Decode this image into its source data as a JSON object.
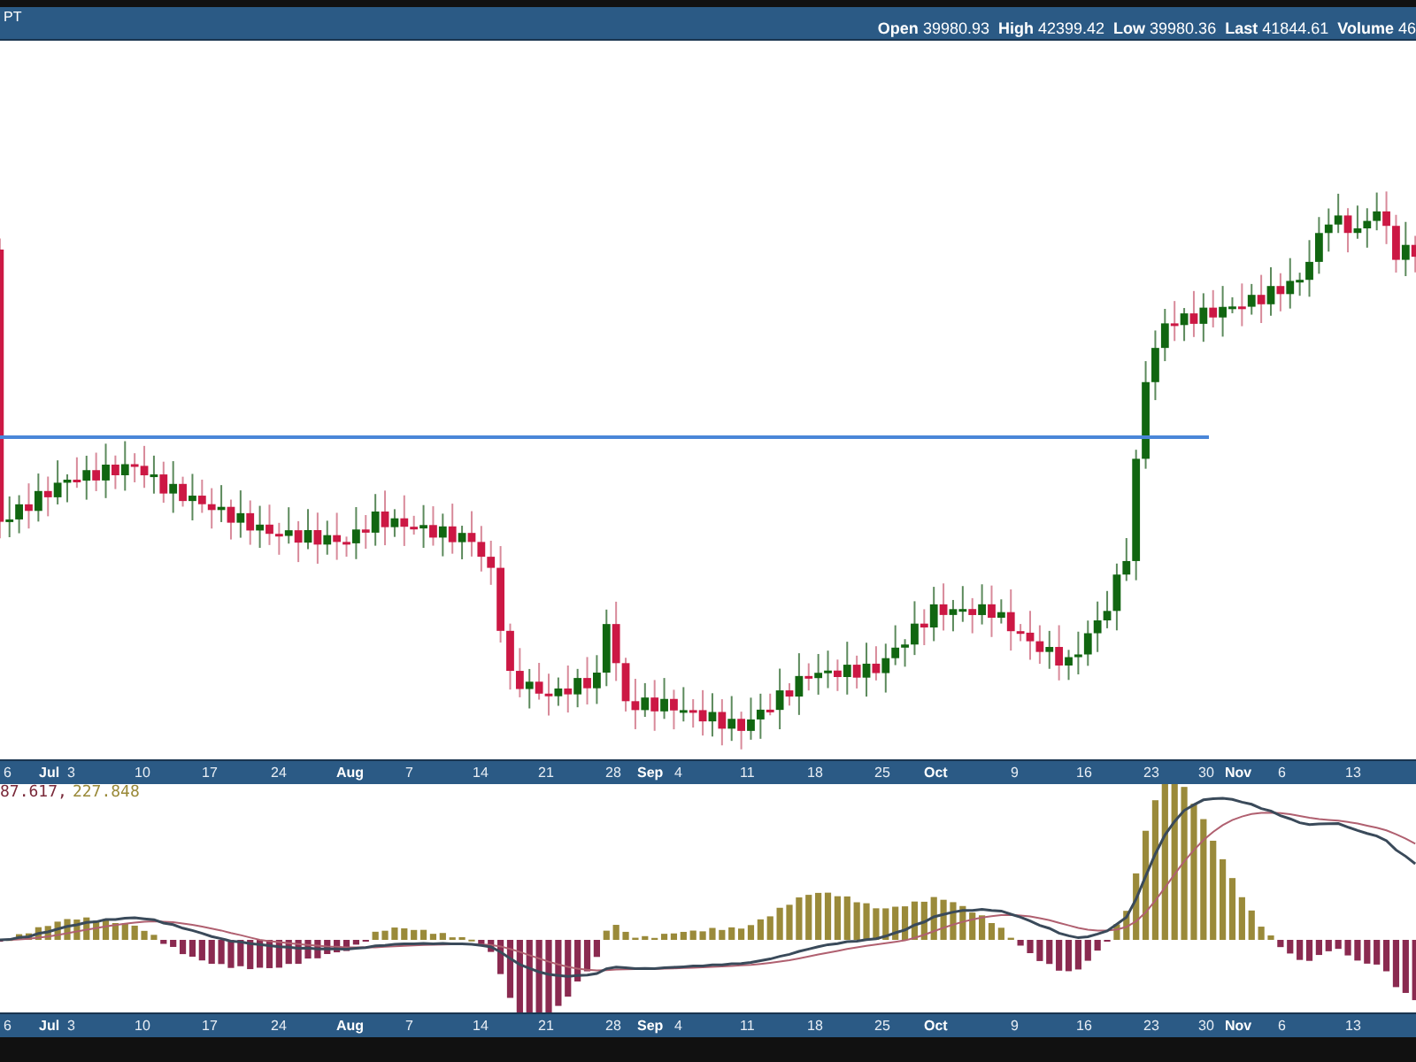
{
  "header": {
    "symbol": "PT",
    "stats": [
      {
        "label": "Open",
        "value": "39980.93"
      },
      {
        "label": "High",
        "value": "42399.42"
      },
      {
        "label": "Low",
        "value": "39980.36"
      },
      {
        "label": "Last",
        "value": "41844.61"
      },
      {
        "label": "Volume",
        "value": "46"
      }
    ]
  },
  "price_axis": {
    "labels": [
      {
        "text": "6",
        "kind": "day"
      },
      {
        "text": "Jul",
        "kind": "month"
      },
      {
        "text": "3",
        "kind": "day"
      },
      {
        "text": "10",
        "kind": "day"
      },
      {
        "text": "17",
        "kind": "day"
      },
      {
        "text": "24",
        "kind": "day"
      },
      {
        "text": "Aug",
        "kind": "month"
      },
      {
        "text": "7",
        "kind": "day"
      },
      {
        "text": "14",
        "kind": "day"
      },
      {
        "text": "21",
        "kind": "day"
      },
      {
        "text": "28",
        "kind": "day"
      },
      {
        "text": "Sep",
        "kind": "month"
      },
      {
        "text": "4",
        "kind": "day"
      },
      {
        "text": "11",
        "kind": "day"
      },
      {
        "text": "18",
        "kind": "day"
      },
      {
        "text": "25",
        "kind": "day"
      },
      {
        "text": "Oct",
        "kind": "month"
      },
      {
        "text": "9",
        "kind": "day"
      },
      {
        "text": "16",
        "kind": "day"
      },
      {
        "text": "23",
        "kind": "day"
      },
      {
        "text": "30",
        "kind": "day"
      },
      {
        "text": "Nov",
        "kind": "month"
      },
      {
        "text": "6",
        "kind": "day"
      },
      {
        "text": "13",
        "kind": "day"
      }
    ]
  },
  "macd_legend": [
    {
      "text": "87.617,",
      "color": "#7a2a3a"
    },
    {
      "text": "227.848",
      "color": "#9a8a3a"
    }
  ],
  "macd_axis": {
    "labels": [
      {
        "text": "6",
        "kind": "day"
      },
      {
        "text": "Jul",
        "kind": "month"
      },
      {
        "text": "3",
        "kind": "day"
      },
      {
        "text": "10",
        "kind": "day"
      },
      {
        "text": "17",
        "kind": "day"
      },
      {
        "text": "24",
        "kind": "day"
      },
      {
        "text": "Aug",
        "kind": "month"
      },
      {
        "text": "7",
        "kind": "day"
      },
      {
        "text": "14",
        "kind": "day"
      },
      {
        "text": "21",
        "kind": "day"
      },
      {
        "text": "28",
        "kind": "day"
      },
      {
        "text": "Sep",
        "kind": "month"
      },
      {
        "text": "4",
        "kind": "day"
      },
      {
        "text": "11",
        "kind": "day"
      },
      {
        "text": "18",
        "kind": "day"
      },
      {
        "text": "25",
        "kind": "day"
      },
      {
        "text": "Oct",
        "kind": "month"
      },
      {
        "text": "9",
        "kind": "day"
      },
      {
        "text": "16",
        "kind": "day"
      },
      {
        "text": "23",
        "kind": "day"
      },
      {
        "text": "30",
        "kind": "day"
      },
      {
        "text": "Nov",
        "kind": "month"
      },
      {
        "text": "6",
        "kind": "day"
      },
      {
        "text": "13",
        "kind": "day"
      }
    ]
  }
}
